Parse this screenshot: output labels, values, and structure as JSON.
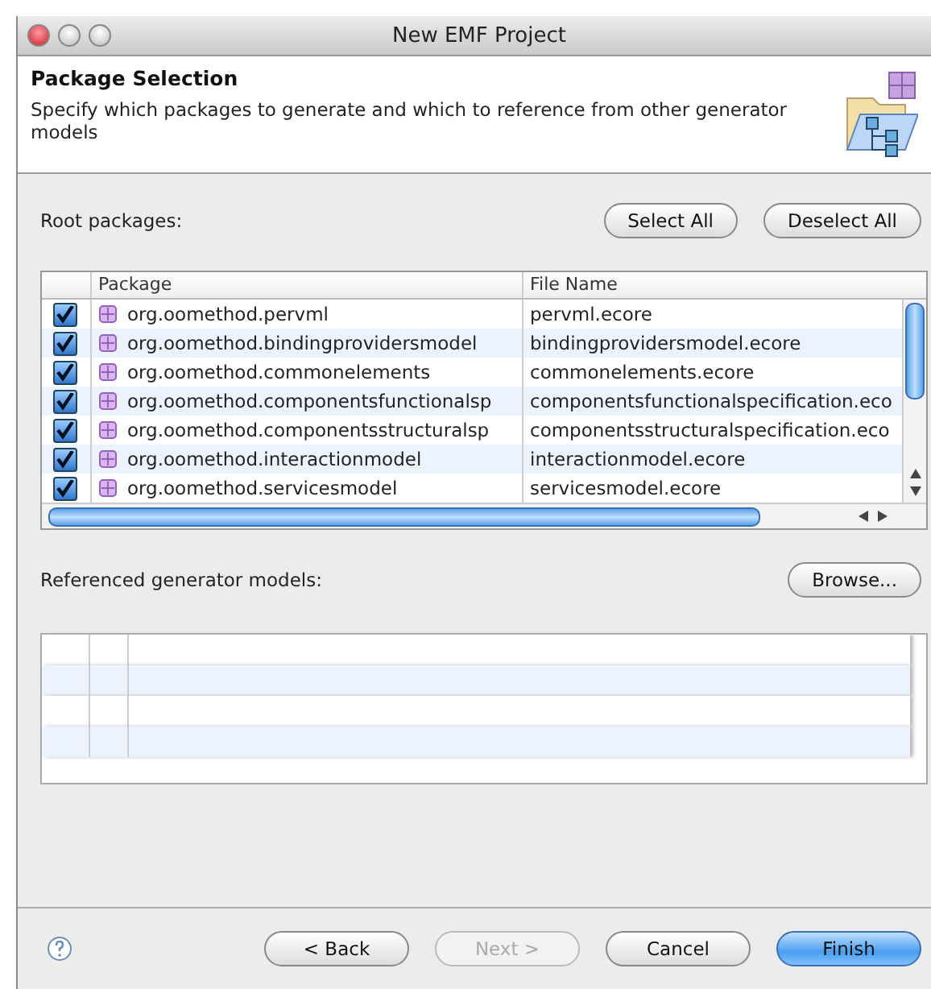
{
  "window": {
    "title": "New EMF Project"
  },
  "header": {
    "title": "Package Selection",
    "description": "Specify which packages to generate and which to reference from other generator models"
  },
  "root_packages": {
    "label": "Root packages:",
    "buttons": [
      "Select All",
      "Deselect All"
    ],
    "columns": [
      "Package",
      "File Name"
    ],
    "rows": [
      {
        "checked": true,
        "package": "org.oomethod.pervml",
        "file_name": "pervml.ecore"
      },
      {
        "checked": true,
        "package": "org.oomethod.bindingprovidersmodel",
        "file_name": "bindingprovidersmodel.ecore"
      },
      {
        "checked": true,
        "package": "org.oomethod.commonelements",
        "file_name": "commonelements.ecore"
      },
      {
        "checked": true,
        "package": "org.oomethod.componentsfunctionalsp",
        "file_name": "componentsfunctionalspecification.eco"
      },
      {
        "checked": true,
        "package": "org.oomethod.componentsstructuralsp",
        "file_name": "componentsstructuralspecification.eco"
      },
      {
        "checked": true,
        "package": "org.oomethod.interactionmodel",
        "file_name": "interactionmodel.ecore"
      },
      {
        "checked": true,
        "package": "org.oomethod.servicesmodel",
        "file_name": "servicesmodel.ecore"
      }
    ]
  },
  "referenced_models": {
    "label": "Referenced generator models:",
    "button": "Browse..."
  },
  "footer": {
    "buttons": [
      {
        "label": "< Back",
        "disabled": false,
        "default": false
      },
      {
        "label": "Next >",
        "disabled": true,
        "default": false
      },
      {
        "label": "Cancel",
        "disabled": false,
        "default": false
      },
      {
        "label": "Finish",
        "disabled": false,
        "default": true
      }
    ]
  }
}
